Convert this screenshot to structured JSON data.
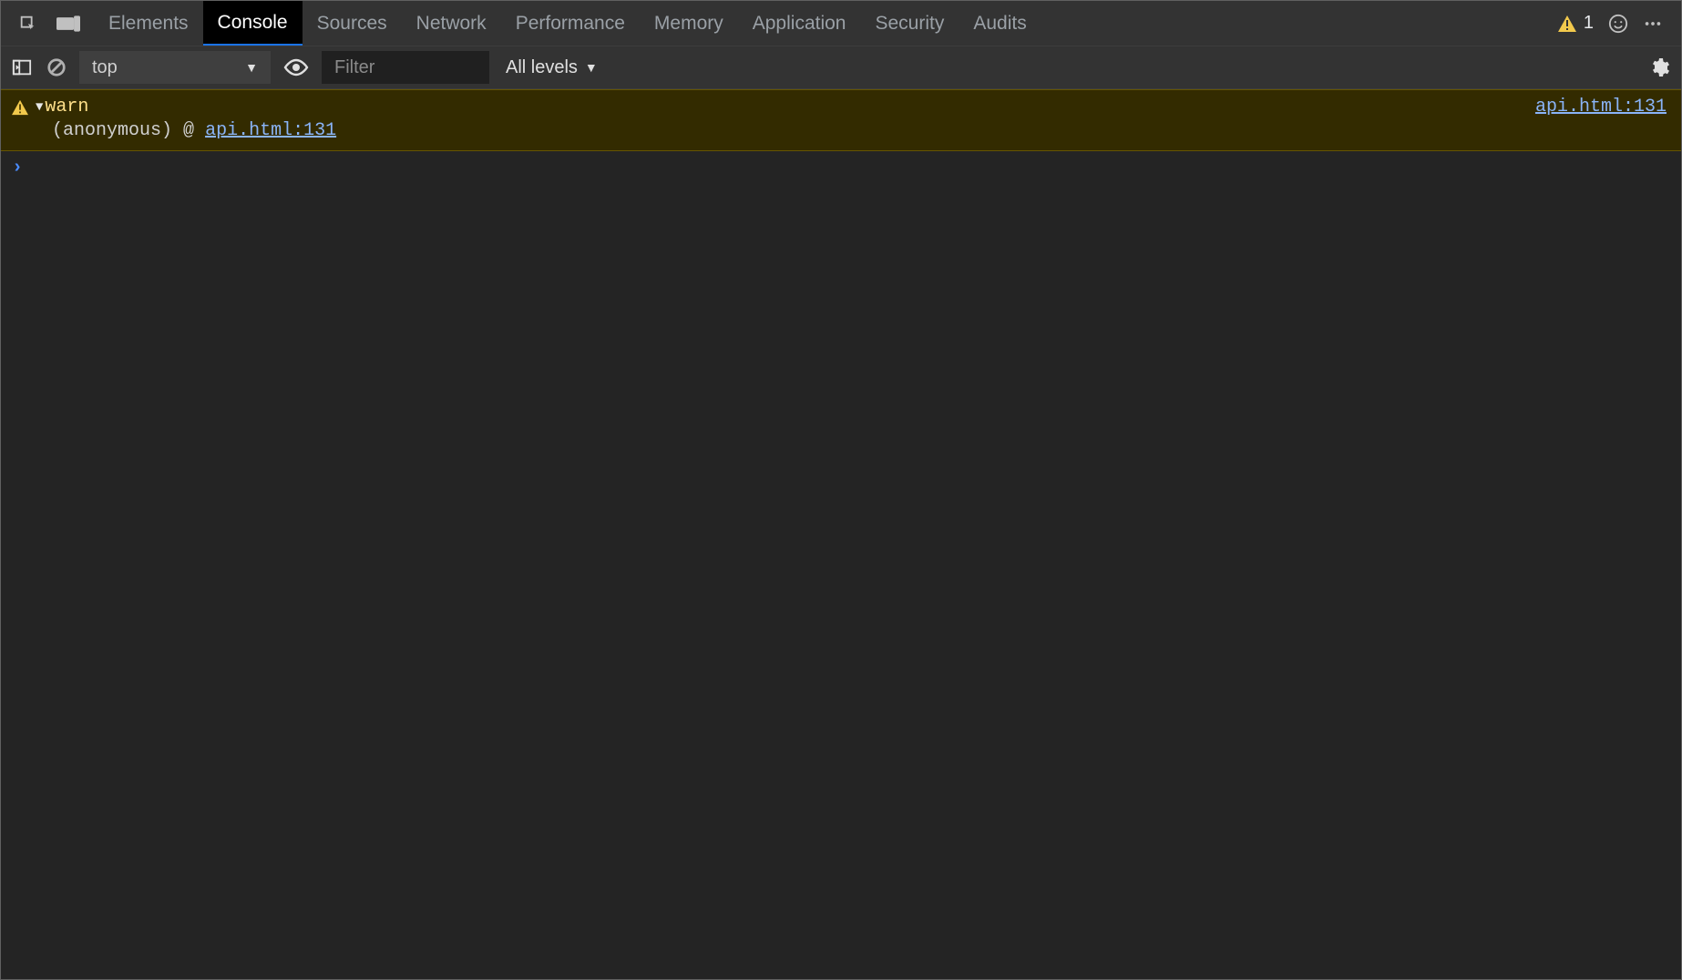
{
  "tabs": {
    "items": [
      {
        "label": "Elements",
        "active": false
      },
      {
        "label": "Console",
        "active": true
      },
      {
        "label": "Sources",
        "active": false
      },
      {
        "label": "Network",
        "active": false
      },
      {
        "label": "Performance",
        "active": false
      },
      {
        "label": "Memory",
        "active": false
      },
      {
        "label": "Application",
        "active": false
      },
      {
        "label": "Security",
        "active": false
      },
      {
        "label": "Audits",
        "active": false
      }
    ]
  },
  "status": {
    "warning_count": "1"
  },
  "toolbar": {
    "context": "top",
    "filter_placeholder": "Filter",
    "levels_label": "All levels"
  },
  "logs": {
    "warn": {
      "method": "warn",
      "anon": "(anonymous)",
      "at": "@",
      "source": "api.html:131"
    }
  }
}
